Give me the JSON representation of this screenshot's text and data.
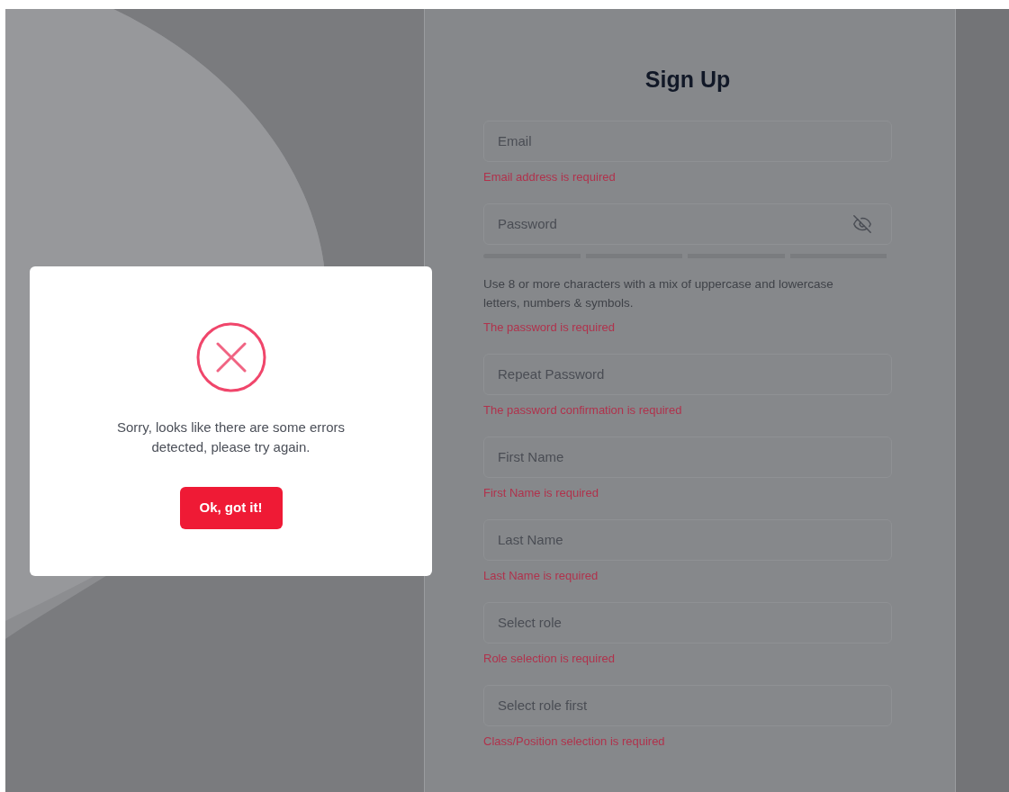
{
  "form": {
    "title": "Sign Up",
    "fields": [
      {
        "kind": "text",
        "placeholder": "Email",
        "error": "Email address is required"
      },
      {
        "kind": "password",
        "placeholder": "Password",
        "hint": "Use 8 or more characters with a mix of uppercase and lowercase letters, numbers & symbols.",
        "error": "The password is required"
      },
      {
        "kind": "text",
        "placeholder": "Repeat Password",
        "error": "The password confirmation is required"
      },
      {
        "kind": "text",
        "placeholder": "First Name",
        "error": "First Name is required"
      },
      {
        "kind": "text",
        "placeholder": "Last Name",
        "error": "Last Name is required"
      },
      {
        "kind": "select",
        "placeholder": "Select role",
        "error": "Role selection is required"
      },
      {
        "kind": "select",
        "placeholder": "Select role first",
        "error": "Class/Position selection is required"
      }
    ]
  },
  "dialog": {
    "message": "Sorry, looks like there are some errors detected, please try again.",
    "button": "Ok, got it!"
  }
}
